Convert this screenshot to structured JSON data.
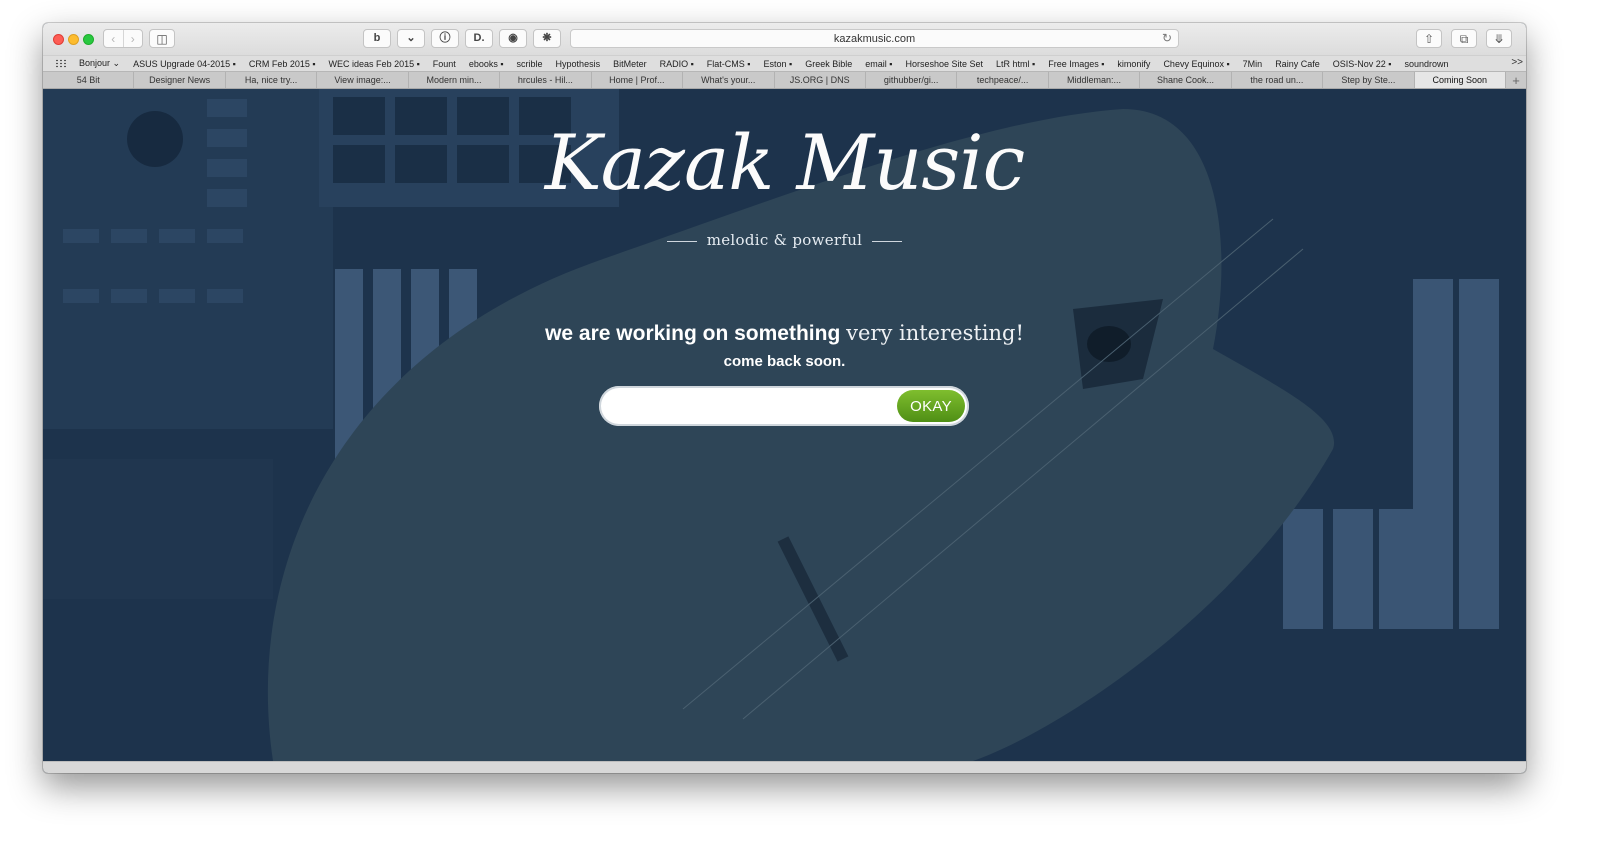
{
  "browser": {
    "url": "kazakmusic.com",
    "bookmarks": [
      "Bonjour ⌄",
      "ASUS Upgrade 04-2015 ▪",
      "CRM Feb 2015 ▪",
      "WEC ideas Feb 2015 ▪",
      "Fount",
      "ebooks ▪",
      "scrible",
      "Hypothesis",
      "BitMeter",
      "RADIO ▪",
      "Flat-CMS ▪",
      "Eston ▪",
      "Greek Bible",
      "email ▪",
      "Horseshoe Site Set",
      "LtR html ▪",
      "Free Images ▪",
      "kimonify",
      "Chevy Equinox ▪",
      "7Min",
      "Rainy Cafe",
      "OSIS-Nov 22 ▪",
      "soundrown"
    ],
    "bookmarks_more": ">>",
    "tabs": [
      "54 Bit",
      "Designer News",
      "Ha, nice try...",
      "View image:...",
      "Modern min...",
      "hrcules - Hil...",
      "Home | Prof...",
      "What's your...",
      "JS.ORG | DNS",
      "githubber/gi...",
      "techpeace/...",
      "Middleman:...",
      "Shane Cook...",
      "the road un...",
      "Step by Ste...",
      "Coming Soon"
    ],
    "active_tab_index": 15,
    "new_tab": "+"
  },
  "page": {
    "logo": "Kazak Music",
    "tagline": "melodic & powerful",
    "headline_bold": "we are working on something",
    "headline_light": "very interesting!",
    "subline": "come back soon.",
    "email_value": "",
    "submit_label": "OKAY"
  },
  "colors": {
    "overlay": "#1f3650",
    "button_green": "#5f9f1d"
  }
}
